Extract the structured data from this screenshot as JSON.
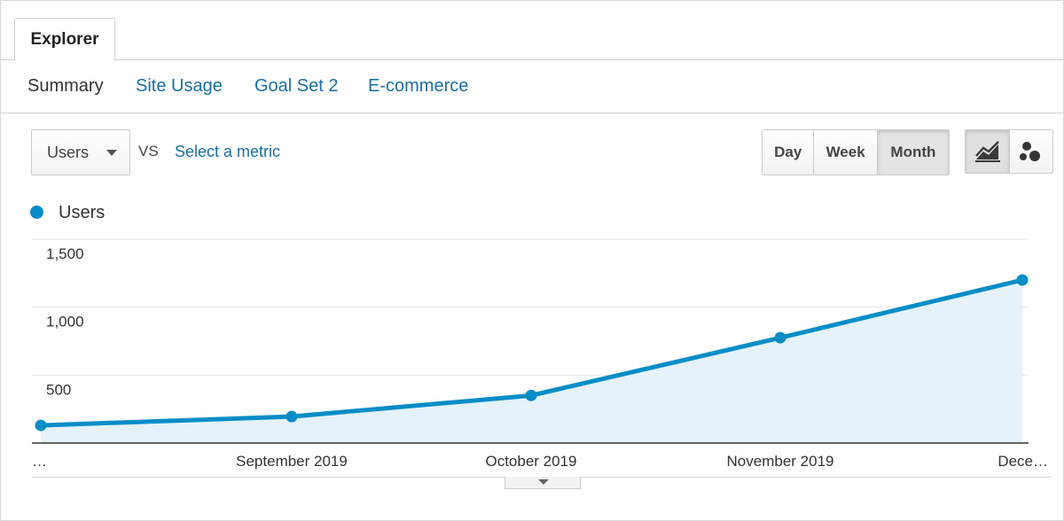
{
  "tabs": {
    "explorer": "Explorer"
  },
  "subnav": {
    "summary": "Summary",
    "site_usage": "Site Usage",
    "goal_set": "Goal Set 2",
    "ecommerce": "E-commerce"
  },
  "controls": {
    "metric_selected": "Users",
    "vs_label": "VS",
    "select_metric": "Select a metric",
    "periods": [
      "Day",
      "Week",
      "Month"
    ],
    "active_period": "Month",
    "view_icons": [
      "line-chart-icon",
      "motion-chart-icon"
    ]
  },
  "legend": {
    "label": "Users",
    "color": "#058dc7"
  },
  "colors": {
    "series": "#058dc7",
    "area": "#e5f2f9",
    "link": "#1a6ea4",
    "grid": "#e6e6e6"
  },
  "chart_data": {
    "type": "area",
    "x": [
      "…",
      "September 2019",
      "October 2019",
      "November 2019",
      "Dece…"
    ],
    "series": [
      {
        "name": "Users",
        "values": [
          130,
          195,
          350,
          775,
          1200
        ]
      }
    ],
    "ytick_labels": [
      "1,500",
      "1,000",
      "500"
    ],
    "yticks": [
      1500,
      1000,
      500
    ],
    "ylim": [
      0,
      1500
    ],
    "grid": true,
    "legend": "top-left"
  }
}
